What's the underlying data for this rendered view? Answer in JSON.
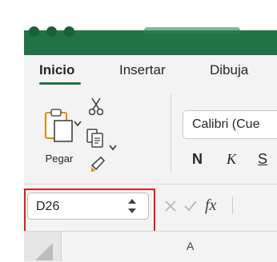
{
  "ribbon": {
    "tabs": [
      {
        "label": "Inicio",
        "active": true
      },
      {
        "label": "Insertar",
        "active": false
      },
      {
        "label": "Dibuja",
        "active": false
      }
    ],
    "accent_color": "#217346"
  },
  "clipboard": {
    "paste_label": "Pegar",
    "icons": [
      "paste-icon",
      "scissors-icon",
      "copy-icon",
      "format-painter-icon"
    ]
  },
  "font": {
    "name": "Calibri (Cue",
    "bold_label": "N",
    "italic_label": "K",
    "underline_label": "S"
  },
  "formula_bar": {
    "name_box_value": "D26",
    "fx_label": "fx",
    "highlight_color": "#e21b1b"
  },
  "sheet": {
    "column_header": "A"
  }
}
